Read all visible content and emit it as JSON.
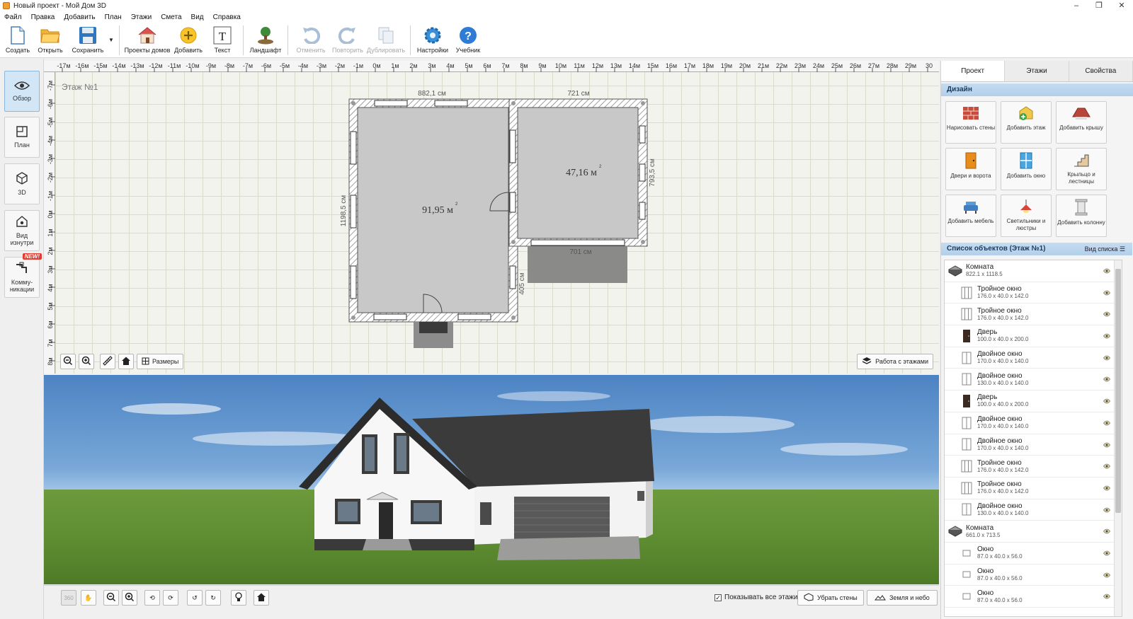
{
  "window": {
    "title": "Новый проект - Мой Дом 3D",
    "controls": [
      "–",
      "❐",
      "✕"
    ]
  },
  "menu": [
    "Файл",
    "Правка",
    "Добавить",
    "План",
    "Этажи",
    "Смета",
    "Вид",
    "Справка"
  ],
  "toolbar": [
    {
      "label": "Создать",
      "icon": "new-file-icon",
      "enabled": true
    },
    {
      "label": "Открыть",
      "icon": "open-folder-icon",
      "enabled": true
    },
    {
      "label": "Сохранить",
      "icon": "save-icon",
      "enabled": true
    },
    {
      "label": "Проекты домов",
      "icon": "house-projects-icon",
      "enabled": true
    },
    {
      "label": "Добавить",
      "icon": "add-icon",
      "enabled": true
    },
    {
      "label": "Текст",
      "icon": "text-icon",
      "enabled": true
    },
    {
      "label": "Ландшафт",
      "icon": "landscape-tree-icon",
      "enabled": true
    },
    {
      "label": "Отменить",
      "icon": "undo-icon",
      "enabled": false
    },
    {
      "label": "Повторить",
      "icon": "redo-icon",
      "enabled": false
    },
    {
      "label": "Дублировать",
      "icon": "duplicate-icon",
      "enabled": false
    },
    {
      "label": "Настройки",
      "icon": "settings-gear-icon",
      "enabled": true
    },
    {
      "label": "Учебник",
      "icon": "help-icon",
      "enabled": true
    }
  ],
  "leftnav": [
    {
      "label": "Обзор",
      "icon": "eye-icon",
      "active": true
    },
    {
      "label": "План",
      "icon": "plan-icon",
      "active": false
    },
    {
      "label": "3D",
      "icon": "cube-3d-icon",
      "active": false
    },
    {
      "label": "Вид изнутри",
      "icon": "inside-view-icon",
      "active": false
    },
    {
      "label": "Комму-никации",
      "icon": "communications-icon",
      "active": false,
      "badge": "NEW!"
    }
  ],
  "plan": {
    "floor_label": "Этаж №1",
    "ruler_x": [
      "-17м",
      "-16м",
      "-15м",
      "-14м",
      "-13м",
      "-12м",
      "-11м",
      "-10м",
      "-9м",
      "-8м",
      "-7м",
      "-6м",
      "-5м",
      "-4м",
      "-3м",
      "-2м",
      "-1м",
      "0м",
      "1м",
      "2м",
      "3м",
      "4м",
      "5м",
      "6м",
      "7м",
      "8м",
      "9м",
      "10м",
      "11м",
      "12м",
      "13м",
      "14м",
      "15м",
      "16м",
      "17м",
      "18м",
      "19м",
      "20м",
      "21м",
      "22м",
      "23м",
      "24м",
      "25м",
      "26м",
      "27м",
      "28м",
      "29м",
      "30"
    ],
    "ruler_y": [
      "-7м",
      "-6м",
      "-5м",
      "-4м",
      "-3м",
      "-2м",
      "-1м",
      "0м",
      "1м",
      "2м",
      "3м",
      "4м",
      "5м",
      "6м",
      "7м",
      "8м"
    ],
    "dims": {
      "top_left": "882,1 см",
      "top_right": "721 см",
      "left": "1198,5 см",
      "right": "793,5 см",
      "garage_front": "701 см",
      "garage_side": "405 см"
    },
    "rooms": [
      {
        "area": "91,95 м",
        "sup": "2"
      },
      {
        "area": "47,16 м",
        "sup": "2"
      }
    ],
    "tools_dims_label": "Размеры",
    "floors_button": "Работа с этажами"
  },
  "view3d_bar": {
    "show_all_floors": "Показывать все этажи",
    "remove_walls": "Убрать стены",
    "ground_sky": "Земля и небо"
  },
  "right": {
    "tabs": [
      "Проект",
      "Этажи",
      "Свойства"
    ],
    "active_tab": 0,
    "design_header": "Дизайн",
    "design_buttons": [
      {
        "label": "Нарисовать стены",
        "icon": "brick-wall-icon"
      },
      {
        "label": "Добавить этаж",
        "icon": "add-floor-icon"
      },
      {
        "label": "Добавить крышу",
        "icon": "roof-icon"
      },
      {
        "label": "Двери и ворота",
        "icon": "door-icon"
      },
      {
        "label": "Добавить окно",
        "icon": "window-icon"
      },
      {
        "label": "Крыльцо и лестницы",
        "icon": "stairs-icon"
      },
      {
        "label": "Добавить мебель",
        "icon": "armchair-icon"
      },
      {
        "label": "Светильники и люстры",
        "icon": "lamp-icon"
      },
      {
        "label": "Добавить колонну",
        "icon": "column-icon"
      }
    ],
    "objects_header": "Список объектов (Этаж №1)",
    "list_view": "Вид списка",
    "objects": [
      {
        "name": "Комната",
        "dims": "822.1 x 1118.5",
        "kind": "room",
        "indent": false
      },
      {
        "name": "Тройное окно",
        "dims": "176.0 x 40.0 x 142.0",
        "kind": "window3",
        "indent": true
      },
      {
        "name": "Тройное окно",
        "dims": "176.0 x 40.0 x 142.0",
        "kind": "window3",
        "indent": true
      },
      {
        "name": "Дверь",
        "dims": "100.0 x 40.0 x 200.0",
        "kind": "door",
        "indent": true
      },
      {
        "name": "Двойное окно",
        "dims": "170.0 x 40.0 x 140.0",
        "kind": "window2",
        "indent": true
      },
      {
        "name": "Двойное окно",
        "dims": "130.0 x 40.0 x 140.0",
        "kind": "window2",
        "indent": true
      },
      {
        "name": "Дверь",
        "dims": "100.0 x 40.0 x 200.0",
        "kind": "door",
        "indent": true
      },
      {
        "name": "Двойное окно",
        "dims": "170.0 x 40.0 x 140.0",
        "kind": "window2",
        "indent": true
      },
      {
        "name": "Двойное окно",
        "dims": "170.0 x 40.0 x 140.0",
        "kind": "window2",
        "indent": true
      },
      {
        "name": "Тройное окно",
        "dims": "176.0 x 40.0 x 142.0",
        "kind": "window3",
        "indent": true
      },
      {
        "name": "Тройное окно",
        "dims": "176.0 x 40.0 x 142.0",
        "kind": "window3",
        "indent": true
      },
      {
        "name": "Двойное окно",
        "dims": "130.0 x 40.0 x 140.0",
        "kind": "window2",
        "indent": true
      },
      {
        "name": "Комната",
        "dims": "661.0 x 713.5",
        "kind": "room",
        "indent": false
      },
      {
        "name": "Окно",
        "dims": "87.0 x 40.0 x 56.0",
        "kind": "window1",
        "indent": true
      },
      {
        "name": "Окно",
        "dims": "87.0 x 40.0 x 56.0",
        "kind": "window1",
        "indent": true
      },
      {
        "name": "Окно",
        "dims": "87.0 x 40.0 x 56.0",
        "kind": "window1",
        "indent": true
      }
    ]
  }
}
